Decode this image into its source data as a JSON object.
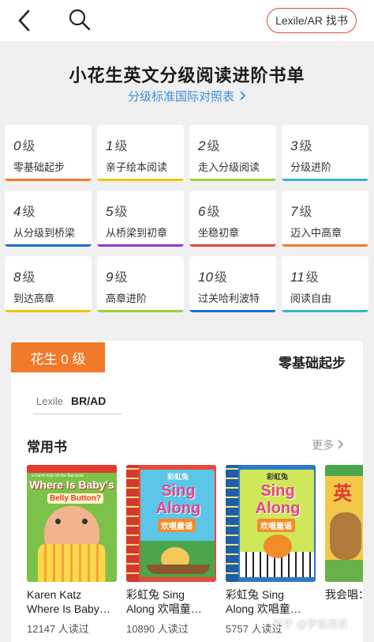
{
  "header": {
    "lexile_button": "Lexile/AR 找书"
  },
  "page": {
    "title": "小花生英文分级阅读进阶书单",
    "subtitle": "分级标准国际对照表"
  },
  "levels": [
    {
      "num": "0",
      "unit": "级",
      "desc": "零基础起步",
      "color": "#f07a2a"
    },
    {
      "num": "1",
      "unit": "级",
      "desc": "亲子绘本阅读",
      "color": "#f2c400"
    },
    {
      "num": "2",
      "unit": "级",
      "desc": "走入分级阅读",
      "color": "#9ccf3c"
    },
    {
      "num": "3",
      "unit": "级",
      "desc": "分级进阶",
      "color": "#37b6c8"
    },
    {
      "num": "4",
      "unit": "级",
      "desc": "从分级到桥梁",
      "color": "#1e6fd0"
    },
    {
      "num": "5",
      "unit": "级",
      "desc": "从桥梁到初章",
      "color": "#8a3bd0"
    },
    {
      "num": "6",
      "unit": "级",
      "desc": "坐稳初章",
      "color": "#e0463e"
    },
    {
      "num": "7",
      "unit": "级",
      "desc": "迈入中高章",
      "color": "#f07a2a"
    },
    {
      "num": "8",
      "unit": "级",
      "desc": "到达高章",
      "color": "#f2c400"
    },
    {
      "num": "9",
      "unit": "级",
      "desc": "高章进阶",
      "color": "#9ccf3c"
    },
    {
      "num": "10",
      "unit": "级",
      "desc": "过关哈利波特",
      "color": "#1e6fd0"
    },
    {
      "num": "11",
      "unit": "级",
      "desc": "阅读自由",
      "color": "#37b6c8"
    }
  ],
  "level_card": {
    "tag": "花生 0 级",
    "title": "零基础起步",
    "lexile_key": "Lexile",
    "lexile_value": "BR/AD",
    "section": "常用书",
    "more": "更多"
  },
  "books": [
    {
      "title1": "Karen Katz",
      "title2": "Where Is Baby…",
      "reads": "12147 人读过",
      "cover_text1": "Where Is Baby's",
      "cover_text2": "Belly Button?",
      "cover_top": "a Karen Katz lift-the-flap book"
    },
    {
      "title1": "彩虹兔 Sing",
      "title2": "Along 欢唱童…",
      "reads": "10890 人读过",
      "cover_text1": "彩虹兔",
      "cover_text2": "Sing Along",
      "cover_text3": "欢唱童谣"
    },
    {
      "title1": "彩虹兔 Sing",
      "title2": "Along 欢唱童…",
      "reads": "5757 人读过",
      "cover_text1": "彩虹兔",
      "cover_text2": "Sing Along",
      "cover_text3": "欢唱童谣"
    },
    {
      "title1": "我会唱：",
      "title2": "",
      "reads": "",
      "cover_text1": "英"
    }
  ],
  "watermark": "知乎 @学爸阅读"
}
